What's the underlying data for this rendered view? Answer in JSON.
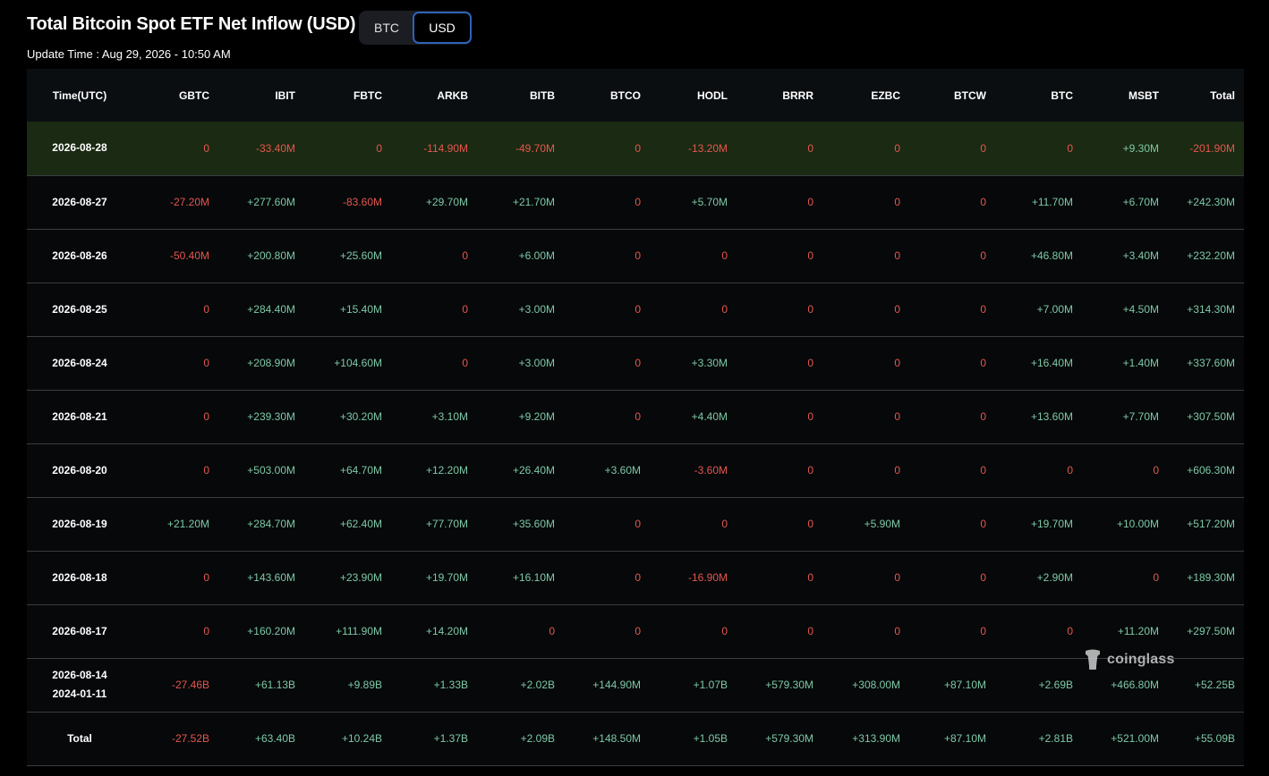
{
  "header": {
    "title": "Total Bitcoin Spot ETF Net Inflow (USD)",
    "toggle": {
      "btc_label": "BTC",
      "usd_label": "USD",
      "selected": "USD"
    },
    "update_time": "Update Time : Aug 29, 2026 - 10:50 AM"
  },
  "table": {
    "columns": [
      "Time(UTC)",
      "GBTC",
      "IBIT",
      "FBTC",
      "ARKB",
      "BITB",
      "BTCO",
      "HODL",
      "BRRR",
      "EZBC",
      "BTCW",
      "BTC",
      "MSBT",
      "Total"
    ],
    "rows": [
      {
        "date": "2026-08-28",
        "date2": "",
        "highlight": true,
        "values": [
          "0",
          "-33.40M",
          "0",
          "-114.90M",
          "-49.70M",
          "0",
          "-13.20M",
          "0",
          "0",
          "0",
          "0",
          "+9.30M",
          "-201.90M"
        ]
      },
      {
        "date": "2026-08-27",
        "date2": "",
        "highlight": false,
        "values": [
          "-27.20M",
          "+277.60M",
          "-83.60M",
          "+29.70M",
          "+21.70M",
          "0",
          "+5.70M",
          "0",
          "0",
          "0",
          "+11.70M",
          "+6.70M",
          "+242.30M"
        ]
      },
      {
        "date": "2026-08-26",
        "date2": "",
        "highlight": false,
        "values": [
          "-50.40M",
          "+200.80M",
          "+25.60M",
          "0",
          "+6.00M",
          "0",
          "0",
          "0",
          "0",
          "0",
          "+46.80M",
          "+3.40M",
          "+232.20M"
        ]
      },
      {
        "date": "2026-08-25",
        "date2": "",
        "highlight": false,
        "values": [
          "0",
          "+284.40M",
          "+15.40M",
          "0",
          "+3.00M",
          "0",
          "0",
          "0",
          "0",
          "0",
          "+7.00M",
          "+4.50M",
          "+314.30M"
        ]
      },
      {
        "date": "2026-08-24",
        "date2": "",
        "highlight": false,
        "values": [
          "0",
          "+208.90M",
          "+104.60M",
          "0",
          "+3.00M",
          "0",
          "+3.30M",
          "0",
          "0",
          "0",
          "+16.40M",
          "+1.40M",
          "+337.60M"
        ]
      },
      {
        "date": "2026-08-21",
        "date2": "",
        "highlight": false,
        "values": [
          "0",
          "+239.30M",
          "+30.20M",
          "+3.10M",
          "+9.20M",
          "0",
          "+4.40M",
          "0",
          "0",
          "0",
          "+13.60M",
          "+7.70M",
          "+307.50M"
        ]
      },
      {
        "date": "2026-08-20",
        "date2": "",
        "highlight": false,
        "values": [
          "0",
          "+503.00M",
          "+64.70M",
          "+12.20M",
          "+26.40M",
          "+3.60M",
          "-3.60M",
          "0",
          "0",
          "0",
          "0",
          "0",
          "+606.30M"
        ]
      },
      {
        "date": "2026-08-19",
        "date2": "",
        "highlight": false,
        "values": [
          "+21.20M",
          "+284.70M",
          "+62.40M",
          "+77.70M",
          "+35.60M",
          "0",
          "0",
          "0",
          "+5.90M",
          "0",
          "+19.70M",
          "+10.00M",
          "+517.20M"
        ]
      },
      {
        "date": "2026-08-18",
        "date2": "",
        "highlight": false,
        "values": [
          "0",
          "+143.60M",
          "+23.90M",
          "+19.70M",
          "+16.10M",
          "0",
          "-16.90M",
          "0",
          "0",
          "0",
          "+2.90M",
          "0",
          "+189.30M"
        ]
      },
      {
        "date": "2026-08-17",
        "date2": "",
        "highlight": false,
        "values": [
          "0",
          "+160.20M",
          "+111.90M",
          "+14.20M",
          "0",
          "0",
          "0",
          "0",
          "0",
          "0",
          "0",
          "+11.20M",
          "+297.50M"
        ]
      },
      {
        "date": "2026-08-14",
        "date2": "2024-01-11",
        "highlight": false,
        "values": [
          "-27.46B",
          "+61.13B",
          "+9.89B",
          "+1.33B",
          "+2.02B",
          "+144.90M",
          "+1.07B",
          "+579.30M",
          "+308.00M",
          "+87.10M",
          "+2.69B",
          "+466.80M",
          "+52.25B"
        ]
      },
      {
        "date": "Total",
        "date2": "",
        "highlight": false,
        "values": [
          "-27.52B",
          "+63.40B",
          "+10.24B",
          "+1.37B",
          "+2.09B",
          "+148.50M",
          "+1.05B",
          "+579.30M",
          "+313.90M",
          "+87.10M",
          "+2.81B",
          "+521.00M",
          "+55.09B"
        ]
      }
    ]
  },
  "watermark": {
    "text": "coinglass",
    "icon": "coinglass-logo-icon"
  },
  "colors": {
    "positive": "#7ec9a6",
    "negative": "#e5574e",
    "highlight_row": "#1b2a12",
    "accent": "#2f62b8"
  }
}
